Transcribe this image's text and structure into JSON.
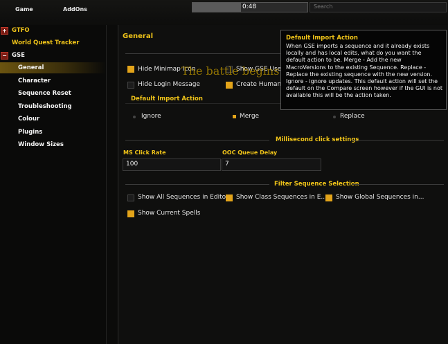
{
  "topbar": {
    "tab_game": "Game",
    "tab_addons": "AddOns",
    "timer": "0:48",
    "timer_progress": 0.42,
    "search_placeholder": "Search"
  },
  "tree": {
    "items": [
      {
        "label": "GTFO",
        "toggle": "+",
        "color": "gold"
      },
      {
        "label": "World Quest Tracker",
        "toggle": "",
        "color": "gold"
      },
      {
        "label": "GSE",
        "toggle": "-",
        "color": "white"
      },
      {
        "label": "General",
        "selected": true
      },
      {
        "label": "Character"
      },
      {
        "label": "Sequence Reset"
      },
      {
        "label": "Troubleshooting"
      },
      {
        "label": "Colour"
      },
      {
        "label": "Plugins"
      },
      {
        "label": "Window Sizes"
      }
    ]
  },
  "main": {
    "title": "General",
    "checkboxes": {
      "hide_minimap": {
        "label": "Hide Minimap Icon",
        "checked": true
      },
      "show_gse_users": {
        "label": "Show GSE Users",
        "checked": false
      },
      "hide_login": {
        "label": "Hide Login Message",
        "checked": false
      },
      "create_human": {
        "label": "Create Human Readable...",
        "checked": true
      }
    },
    "default_import": {
      "heading": "Default Import Action",
      "options": [
        "Ignore",
        "Merge",
        "Replace"
      ],
      "selected": "Merge"
    },
    "ms_section": {
      "heading": "Millisecond click settings",
      "ms_label": "MS Click Rate",
      "ms_value": "100",
      "ooc_label": "OOC Queue Delay",
      "ooc_value": "7"
    },
    "filter_section": {
      "heading": "Filter Sequence Selection",
      "show_all": {
        "label": "Show All Sequences in Editor",
        "checked": false
      },
      "show_class": {
        "label": "Show Class Sequences in E...",
        "checked": true
      },
      "show_global": {
        "label": "Show Global Sequences in...",
        "checked": true
      },
      "show_spells": {
        "label": "Show Current Spells",
        "checked": true
      }
    }
  },
  "overlay": {
    "battle_text": "The battle begins in 1"
  },
  "tooltip": {
    "title": "Default Import Action",
    "body": "When GSE imports a sequence and it already exists locally and has local edits, what do you want the default action to be.  Merge - Add the new MacroVersions to the existing Sequence.  Replace - Replace the existing sequence with the new version. Ignore - ignore updates.  This default action will set the default on the Compare screen however if the GUI is not available this will be the action taken."
  },
  "colors": {
    "accent": "#f0c419",
    "checkbox_on": "#e3a41a",
    "tree_toggle": "#7a1c14"
  }
}
